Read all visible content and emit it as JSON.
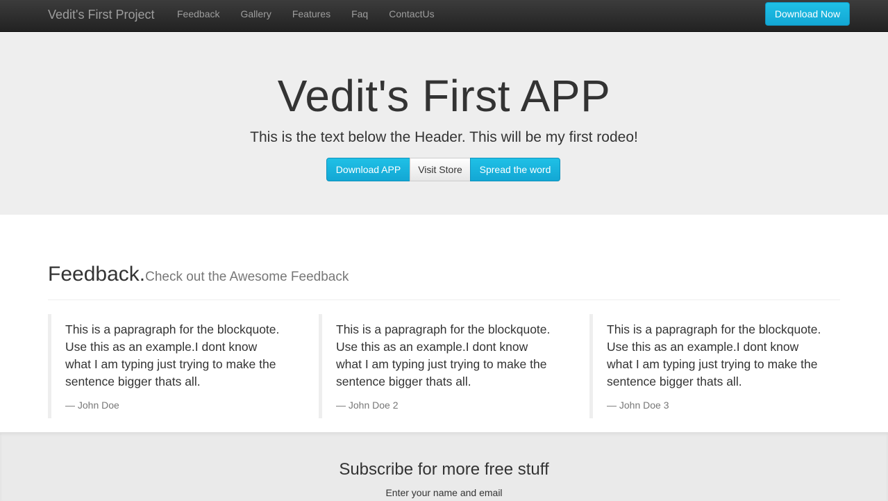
{
  "navbar": {
    "brand": "Vedit's First Project",
    "links": [
      "Feedback",
      "Gallery",
      "Features",
      "Faq",
      "ContactUs"
    ],
    "cta": "Download Now"
  },
  "hero": {
    "title": "Vedit's First APP",
    "subtitle": "This is the text below the Header. This will be my first rodeo!",
    "buttons": [
      "Download APP",
      "Visit Store",
      "Spread the word"
    ]
  },
  "feedback": {
    "title": "Feedback.",
    "subtitle": "Check out the Awesome Feedback",
    "quotes": [
      {
        "text": "This is a papragraph for the blockquote. Use this as an example.I dont know what I am typing just trying to make the sentence bigger thats all.",
        "author": "— John Doe"
      },
      {
        "text": "This is a papragraph for the blockquote. Use this as an example.I dont know what I am typing just trying to make the sentence bigger thats all.",
        "author": "— John Doe 2"
      },
      {
        "text": "This is a papragraph for the blockquote. Use this as an example.I dont know what I am typing just trying to make the sentence bigger thats all.",
        "author": "— John Doe 3"
      }
    ]
  },
  "subscribe": {
    "title": "Subscribe for more free stuff",
    "text": "Enter your name and email"
  },
  "colors": {
    "accent": "#1fc0e6",
    "navbar": "#222222",
    "hero_bg": "#eeeeee"
  }
}
